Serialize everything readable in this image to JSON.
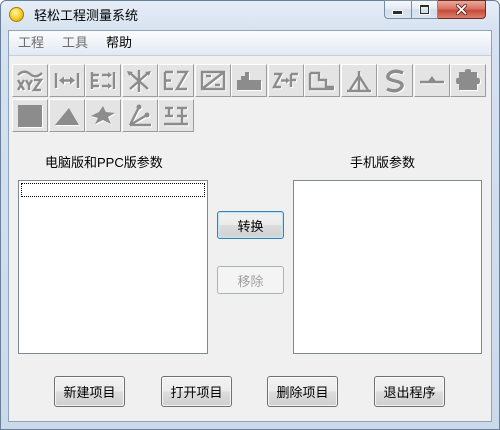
{
  "window": {
    "title": "轻松工程测量系统",
    "icon": "app-coin-icon"
  },
  "menu": {
    "items": [
      {
        "label": "工程",
        "disabled": true
      },
      {
        "label": "工具",
        "disabled": true
      },
      {
        "label": "帮助",
        "disabled": false
      }
    ]
  },
  "toolbar": {
    "disabled": true,
    "rows": [
      [
        "coordinate-xyz-icon",
        "distance-icon",
        "offset-icon",
        "intersection-icon",
        "diagonal-icon",
        "rectangle-diagonal-icon",
        "building-icon",
        "elevation-icon",
        "step-icon",
        "tripod-icon",
        "curve-icon",
        "level-line-icon",
        "puzzle-icon"
      ],
      [
        "block-icon",
        "triangle-area-icon",
        "polygon-area-icon",
        "angle-icon",
        "road-icon"
      ]
    ]
  },
  "labels": {
    "pc_params": "电脑版和PPC版参数",
    "phone_params": "手机版参数"
  },
  "buttons": {
    "convert": "转换",
    "remove": "移除",
    "new_project": "新建项目",
    "open_project": "打开项目",
    "delete_project": "删除项目",
    "exit_program": "退出程序"
  },
  "states": {
    "convert_focused": true,
    "remove_disabled": true,
    "pc_list_focused": true
  },
  "colors": {
    "close_button": "#c74a39",
    "focus_border": "#3c7fb1",
    "disabled_text": "#a0a0a0",
    "toolbar_icon": "#8c8c8c"
  }
}
